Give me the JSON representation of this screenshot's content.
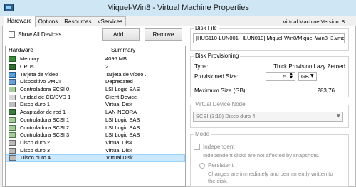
{
  "window": {
    "title": "Miquel-Win8 - Virtual Machine Properties"
  },
  "tabs": [
    {
      "label": "Hardware",
      "active": true
    },
    {
      "label": "Options"
    },
    {
      "label": "Resources"
    },
    {
      "label": "vServices"
    }
  ],
  "vm_version": "Virtual Machine Version: 8",
  "toolbar": {
    "show_all_devices": "Show All Devices",
    "add_label": "Add...",
    "remove_label": "Remove"
  },
  "hardware_table": {
    "columns": [
      "Hardware",
      "Summary"
    ],
    "rows": [
      {
        "icon": "memory-icon",
        "name": "Memory",
        "summary": "4096 MB"
      },
      {
        "icon": "cpu-icon",
        "name": "CPUs",
        "summary": "2"
      },
      {
        "icon": "video-card-icon",
        "name": "Tarjeta de vídeo",
        "summary": "Tarjeta de vídeo ."
      },
      {
        "icon": "vmci-device-icon",
        "name": "Dispositivo VMCI",
        "summary": "Deprecated"
      },
      {
        "icon": "scsi-controller-icon",
        "name": "Controladora SCSI 0",
        "summary": "LSI Logic SAS"
      },
      {
        "icon": "cd-dvd-icon",
        "name": "Unidad de CD/DVD 1",
        "summary": "Client Device"
      },
      {
        "icon": "hard-disk-icon",
        "name": "Disco duro 1",
        "summary": "Virtual Disk"
      },
      {
        "icon": "network-adapter-icon",
        "name": "Adaptador de red 1",
        "summary": "LAN-NCORA"
      },
      {
        "icon": "scsi-controller-icon",
        "name": "Controladora SCSI 1",
        "summary": "LSI Logic SAS"
      },
      {
        "icon": "scsi-controller-icon",
        "name": "Controladora SCSI 2",
        "summary": "LSI Logic SAS"
      },
      {
        "icon": "scsi-controller-icon",
        "name": "Controladora SCSI 3",
        "summary": "LSI Logic SAS"
      },
      {
        "icon": "hard-disk-icon",
        "name": "Disco duro 2",
        "summary": "Virtual Disk"
      },
      {
        "icon": "hard-disk-icon",
        "name": "Disco duro 3",
        "summary": "Virtual Disk"
      },
      {
        "icon": "hard-disk-icon",
        "name": "Disco duro 4",
        "summary": "Virtual Disk",
        "selected": true
      }
    ]
  },
  "disk_file": {
    "label": "Disk File",
    "value": "[HUS110-LUN001-HLUN010] Miquel-Win8/Miquel-Win8_3.vmdk"
  },
  "disk_provisioning": {
    "label": "Disk Provisioning",
    "type_label": "Type:",
    "type_value": "Thick Provision Lazy Zeroed",
    "provisioned_label": "Provisioned Size:",
    "provisioned_value": "5",
    "unit": "GB",
    "max_label": "Maximum Size (GB):",
    "max_value": "283,76"
  },
  "virtual_device_node": {
    "label": "Virtual Device Node",
    "value": "SCSI (3:10) Disco duro 4"
  },
  "mode": {
    "label": "Mode",
    "independent_label": "Independent",
    "independent_desc": "Independent disks are not affected by snapshots.",
    "persistent_label": "Persistent",
    "persistent_desc_1": "Changes are immediately and permanently written to",
    "persistent_desc_2": "the disk."
  }
}
